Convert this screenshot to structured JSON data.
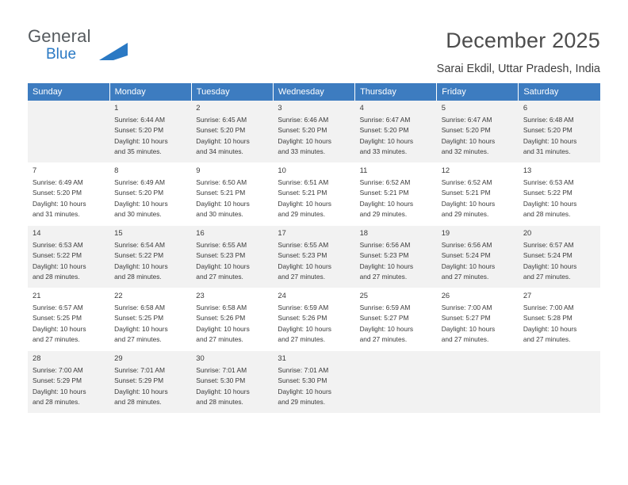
{
  "brand": {
    "name_part1": "General",
    "name_part2": "Blue"
  },
  "header": {
    "title": "December 2025",
    "location": "Sarai Ekdil, Uttar Pradesh, India"
  },
  "calendar": {
    "weekdays": [
      "Sunday",
      "Monday",
      "Tuesday",
      "Wednesday",
      "Thursday",
      "Friday",
      "Saturday"
    ],
    "accent_color": "#3d7cc0",
    "weeks": [
      [
        {
          "day": "",
          "info": ""
        },
        {
          "day": "1",
          "info": "Sunrise: 6:44 AM\nSunset: 5:20 PM\nDaylight: 10 hours\nand 35 minutes."
        },
        {
          "day": "2",
          "info": "Sunrise: 6:45 AM\nSunset: 5:20 PM\nDaylight: 10 hours\nand 34 minutes."
        },
        {
          "day": "3",
          "info": "Sunrise: 6:46 AM\nSunset: 5:20 PM\nDaylight: 10 hours\nand 33 minutes."
        },
        {
          "day": "4",
          "info": "Sunrise: 6:47 AM\nSunset: 5:20 PM\nDaylight: 10 hours\nand 33 minutes."
        },
        {
          "day": "5",
          "info": "Sunrise: 6:47 AM\nSunset: 5:20 PM\nDaylight: 10 hours\nand 32 minutes."
        },
        {
          "day": "6",
          "info": "Sunrise: 6:48 AM\nSunset: 5:20 PM\nDaylight: 10 hours\nand 31 minutes."
        }
      ],
      [
        {
          "day": "7",
          "info": "Sunrise: 6:49 AM\nSunset: 5:20 PM\nDaylight: 10 hours\nand 31 minutes."
        },
        {
          "day": "8",
          "info": "Sunrise: 6:49 AM\nSunset: 5:20 PM\nDaylight: 10 hours\nand 30 minutes."
        },
        {
          "day": "9",
          "info": "Sunrise: 6:50 AM\nSunset: 5:21 PM\nDaylight: 10 hours\nand 30 minutes."
        },
        {
          "day": "10",
          "info": "Sunrise: 6:51 AM\nSunset: 5:21 PM\nDaylight: 10 hours\nand 29 minutes."
        },
        {
          "day": "11",
          "info": "Sunrise: 6:52 AM\nSunset: 5:21 PM\nDaylight: 10 hours\nand 29 minutes."
        },
        {
          "day": "12",
          "info": "Sunrise: 6:52 AM\nSunset: 5:21 PM\nDaylight: 10 hours\nand 29 minutes."
        },
        {
          "day": "13",
          "info": "Sunrise: 6:53 AM\nSunset: 5:22 PM\nDaylight: 10 hours\nand 28 minutes."
        }
      ],
      [
        {
          "day": "14",
          "info": "Sunrise: 6:53 AM\nSunset: 5:22 PM\nDaylight: 10 hours\nand 28 minutes."
        },
        {
          "day": "15",
          "info": "Sunrise: 6:54 AM\nSunset: 5:22 PM\nDaylight: 10 hours\nand 28 minutes."
        },
        {
          "day": "16",
          "info": "Sunrise: 6:55 AM\nSunset: 5:23 PM\nDaylight: 10 hours\nand 27 minutes."
        },
        {
          "day": "17",
          "info": "Sunrise: 6:55 AM\nSunset: 5:23 PM\nDaylight: 10 hours\nand 27 minutes."
        },
        {
          "day": "18",
          "info": "Sunrise: 6:56 AM\nSunset: 5:23 PM\nDaylight: 10 hours\nand 27 minutes."
        },
        {
          "day": "19",
          "info": "Sunrise: 6:56 AM\nSunset: 5:24 PM\nDaylight: 10 hours\nand 27 minutes."
        },
        {
          "day": "20",
          "info": "Sunrise: 6:57 AM\nSunset: 5:24 PM\nDaylight: 10 hours\nand 27 minutes."
        }
      ],
      [
        {
          "day": "21",
          "info": "Sunrise: 6:57 AM\nSunset: 5:25 PM\nDaylight: 10 hours\nand 27 minutes."
        },
        {
          "day": "22",
          "info": "Sunrise: 6:58 AM\nSunset: 5:25 PM\nDaylight: 10 hours\nand 27 minutes."
        },
        {
          "day": "23",
          "info": "Sunrise: 6:58 AM\nSunset: 5:26 PM\nDaylight: 10 hours\nand 27 minutes."
        },
        {
          "day": "24",
          "info": "Sunrise: 6:59 AM\nSunset: 5:26 PM\nDaylight: 10 hours\nand 27 minutes."
        },
        {
          "day": "25",
          "info": "Sunrise: 6:59 AM\nSunset: 5:27 PM\nDaylight: 10 hours\nand 27 minutes."
        },
        {
          "day": "26",
          "info": "Sunrise: 7:00 AM\nSunset: 5:27 PM\nDaylight: 10 hours\nand 27 minutes."
        },
        {
          "day": "27",
          "info": "Sunrise: 7:00 AM\nSunset: 5:28 PM\nDaylight: 10 hours\nand 27 minutes."
        }
      ],
      [
        {
          "day": "28",
          "info": "Sunrise: 7:00 AM\nSunset: 5:29 PM\nDaylight: 10 hours\nand 28 minutes."
        },
        {
          "day": "29",
          "info": "Sunrise: 7:01 AM\nSunset: 5:29 PM\nDaylight: 10 hours\nand 28 minutes."
        },
        {
          "day": "30",
          "info": "Sunrise: 7:01 AM\nSunset: 5:30 PM\nDaylight: 10 hours\nand 28 minutes."
        },
        {
          "day": "31",
          "info": "Sunrise: 7:01 AM\nSunset: 5:30 PM\nDaylight: 10 hours\nand 29 minutes."
        },
        {
          "day": "",
          "info": ""
        },
        {
          "day": "",
          "info": ""
        },
        {
          "day": "",
          "info": ""
        }
      ]
    ]
  }
}
